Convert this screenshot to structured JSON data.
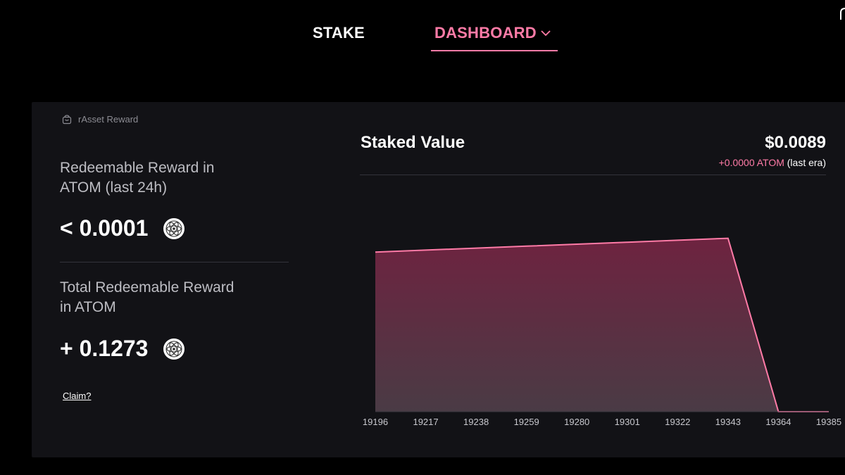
{
  "nav": {
    "stake_label": "STAKE",
    "dashboard_label": "DASHBOARD"
  },
  "reward": {
    "header": "rAsset Reward",
    "redeemable_label": "Redeemable Reward in ATOM (last 24h)",
    "redeemable_value": "< 0.0001",
    "total_label": "Total Redeemable Reward in ATOM",
    "total_value": "+ 0.1273",
    "claim_label": "Claim?"
  },
  "staked": {
    "title": "Staked Value",
    "value": "$0.0089",
    "change": "+0.0000 ATOM",
    "change_suffix": "(last era)"
  },
  "colors": {
    "accent": "#ff7ba7",
    "panel_bg": "#121216"
  },
  "icons": [
    "chevron-down-icon",
    "wallet-icon",
    "atom-icon"
  ],
  "chart_data": {
    "type": "area",
    "categories": [
      "19196",
      "19217",
      "19238",
      "19259",
      "19280",
      "19301",
      "19322",
      "19343",
      "19364",
      "19385"
    ],
    "values": [
      0.0081,
      0.0082,
      0.0083,
      0.0084,
      0.0085,
      0.0086,
      0.0087,
      0.0088,
      0.0,
      0.0
    ],
    "title": "Staked Value",
    "ylim": [
      0,
      0.01
    ],
    "grid": false
  }
}
